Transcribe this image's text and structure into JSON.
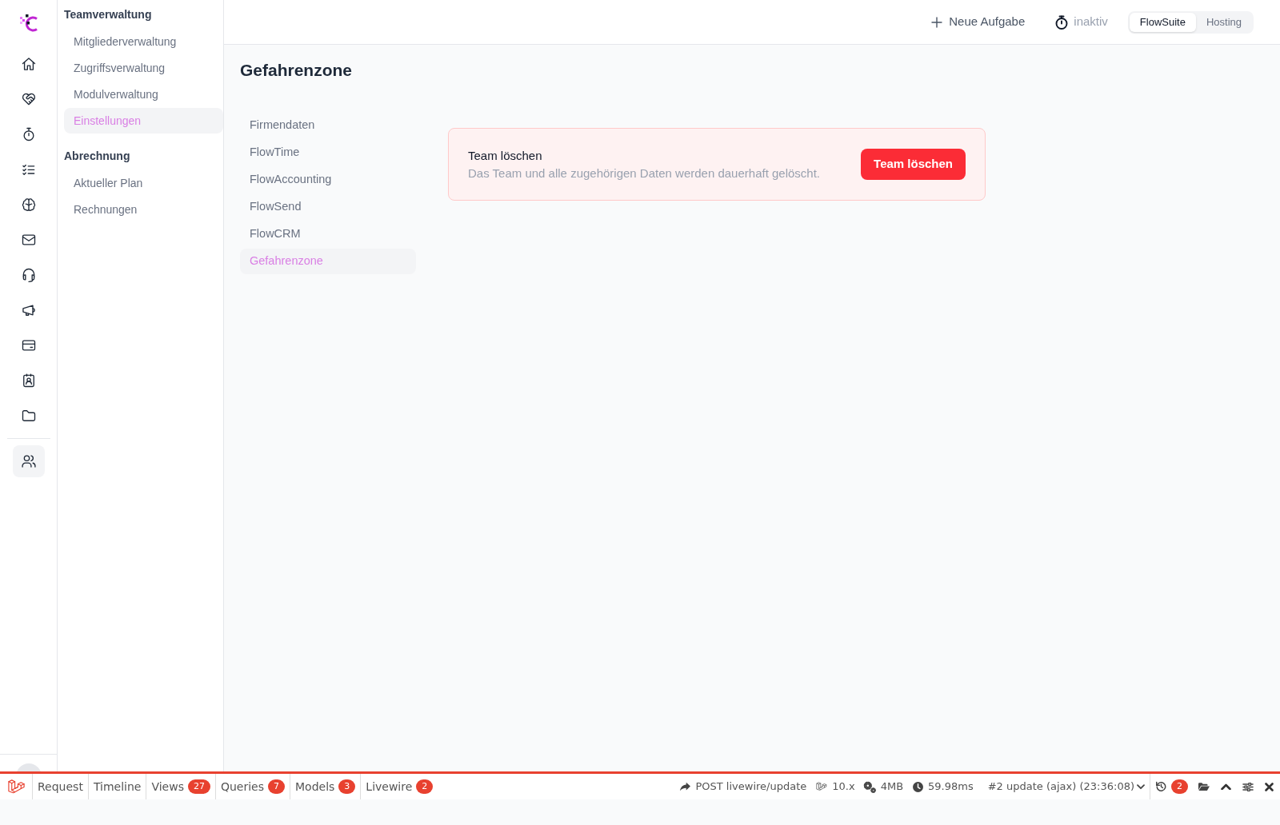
{
  "icon_rail": {
    "main": [
      {
        "selected": false
      },
      {
        "selected": false
      },
      {
        "selected": false
      },
      {
        "selected": false
      },
      {
        "selected": false
      },
      {
        "selected": false
      },
      {
        "selected": false
      },
      {
        "selected": false
      },
      {
        "selected": false
      },
      {
        "selected": false
      },
      {
        "selected": false
      }
    ],
    "secondary": [
      {
        "selected": true
      }
    ]
  },
  "sidebar": {
    "sections": [
      {
        "heading": "Teamverwaltung",
        "items": [
          {
            "label": "Mitgliederverwaltung",
            "selected": false
          },
          {
            "label": "Zugriffsverwaltung",
            "selected": false
          },
          {
            "label": "Modulverwaltung",
            "selected": false
          },
          {
            "label": "Einstellungen",
            "selected": true
          }
        ]
      },
      {
        "heading": "Abrechnung",
        "items": [
          {
            "label": "Aktueller Plan",
            "selected": false
          },
          {
            "label": "Rechnungen",
            "selected": false
          }
        ]
      }
    ]
  },
  "header": {
    "new_task_button": "Neue Aufgabe",
    "timer": {
      "status": "inaktiv"
    },
    "app_switch": [
      {
        "label": "FlowSuite",
        "selected": true
      },
      {
        "label": "Hosting",
        "selected": false
      }
    ]
  },
  "page": {
    "title": "Gefahrenzone",
    "subnav": [
      {
        "label": "Firmendaten",
        "selected": false
      },
      {
        "label": "FlowTime",
        "selected": false
      },
      {
        "label": "FlowAccounting",
        "selected": false
      },
      {
        "label": "FlowSend",
        "selected": false
      },
      {
        "label": "FlowCRM",
        "selected": false
      },
      {
        "label": "Gefahrenzone",
        "selected": true
      }
    ],
    "danger_card": {
      "title": "Team löschen",
      "description": "Das Team und alle zugehörigen Daten werden dauerhaft gelöscht.",
      "button": "Team löschen"
    }
  },
  "debugbar": {
    "tabs": [
      {
        "label": "Request",
        "selected": false
      },
      {
        "label": "Timeline",
        "selected": false
      },
      {
        "label": "Views",
        "count": "27",
        "selected": false
      },
      {
        "label": "Queries",
        "count": "7",
        "selected": false
      },
      {
        "label": "Models",
        "count": "3",
        "selected": false
      },
      {
        "label": "Livewire",
        "count": "2",
        "selected": false
      }
    ],
    "request": "POST livewire/update",
    "version": "10.x",
    "memory": "4MB",
    "duration": "59.98ms",
    "request_select": "#2 update (ajax) (23:36:08)",
    "history_count": "2"
  }
}
